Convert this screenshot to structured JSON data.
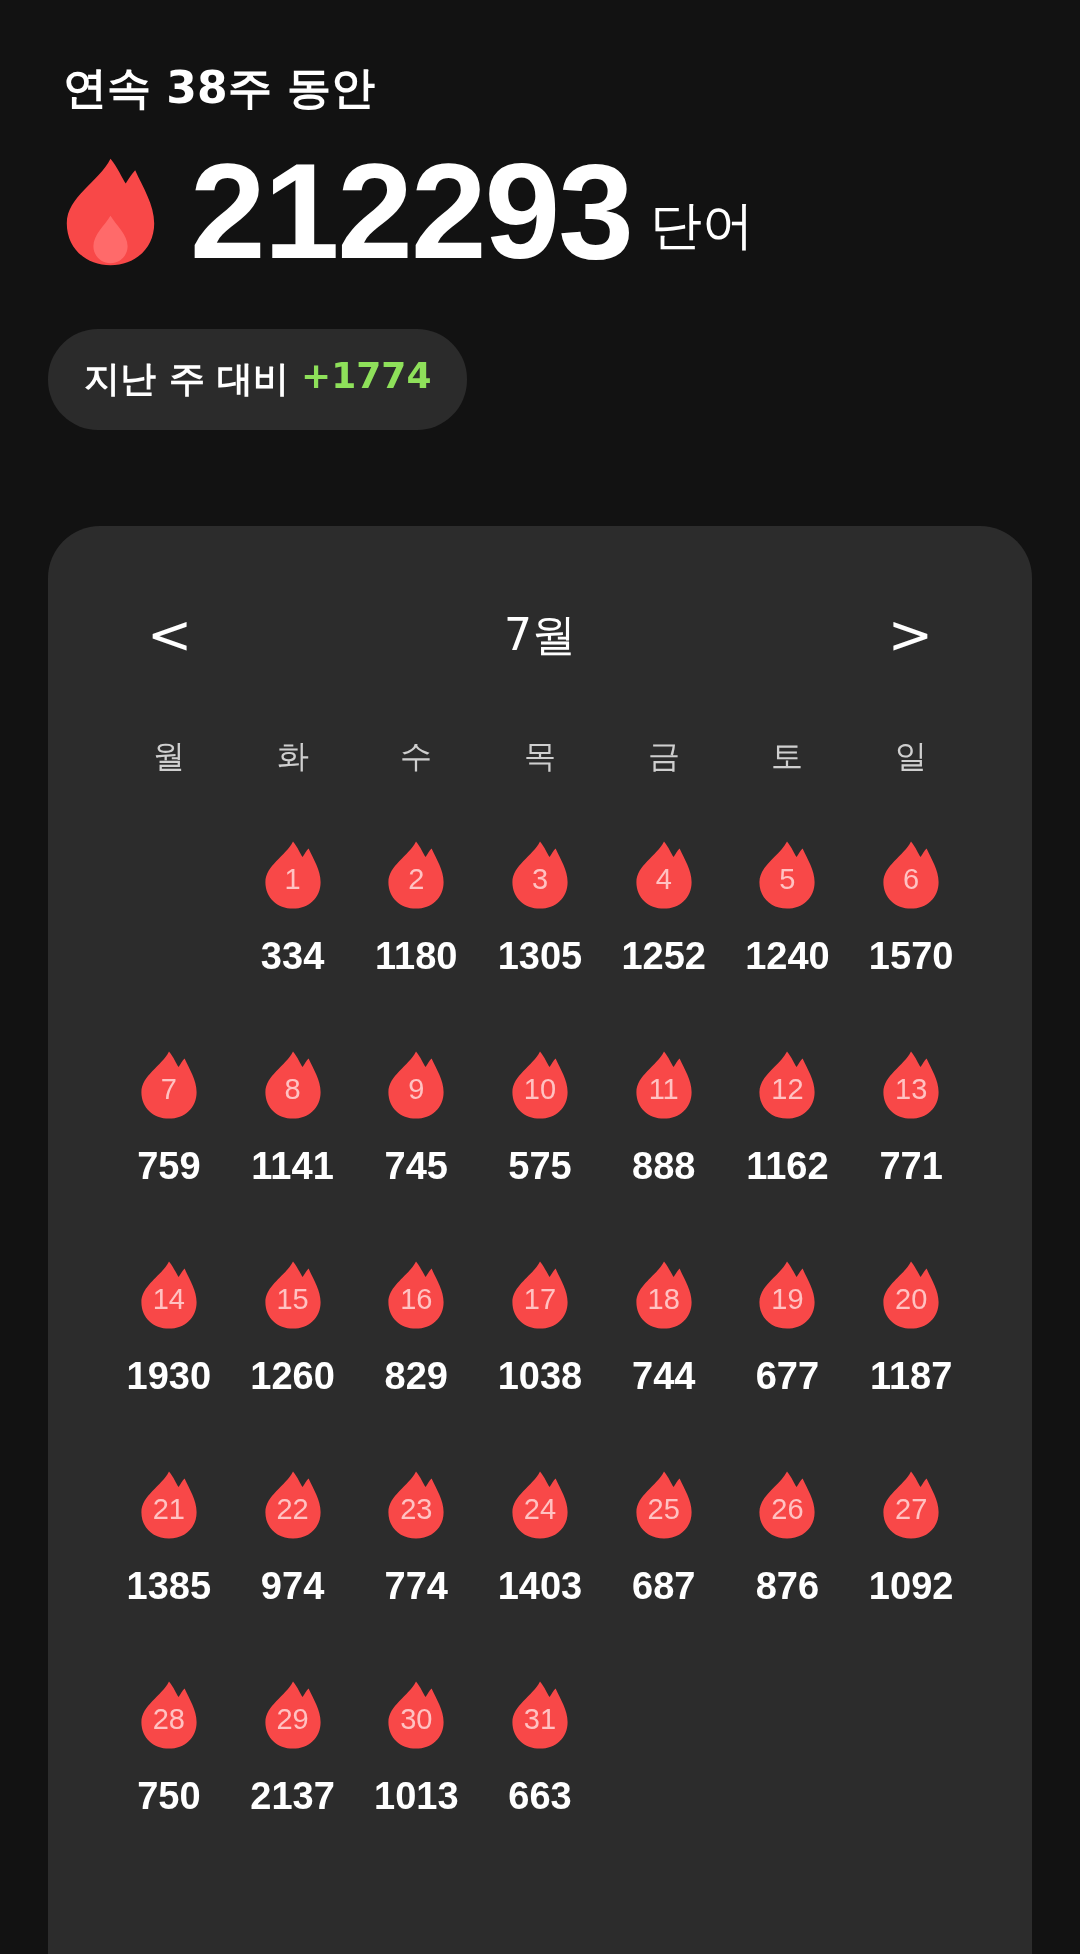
{
  "streak_title": "연속 38주 동안",
  "total": {
    "value": "212293",
    "unit": "단어"
  },
  "comparison": {
    "label": "지난 주 대비",
    "delta": "+1774"
  },
  "calendar": {
    "prev": "<",
    "month": "7월",
    "next": ">",
    "weekdays": [
      "월",
      "화",
      "수",
      "목",
      "금",
      "토",
      "일"
    ],
    "weeks": [
      [
        {
          "kind": "empty"
        },
        {
          "kind": "day",
          "day": "1",
          "words": "334"
        },
        {
          "kind": "day",
          "day": "2",
          "words": "1180"
        },
        {
          "kind": "day",
          "day": "3",
          "words": "1305"
        },
        {
          "kind": "day",
          "day": "4",
          "words": "1252"
        },
        {
          "kind": "day",
          "day": "5",
          "words": "1240"
        },
        {
          "kind": "day",
          "day": "6",
          "words": "1570"
        }
      ],
      [
        {
          "kind": "day",
          "day": "7",
          "words": "759"
        },
        {
          "kind": "day",
          "day": "8",
          "words": "1141"
        },
        {
          "kind": "day",
          "day": "9",
          "words": "745"
        },
        {
          "kind": "day",
          "day": "10",
          "words": "575"
        },
        {
          "kind": "day",
          "day": "11",
          "words": "888"
        },
        {
          "kind": "day",
          "day": "12",
          "words": "1162"
        },
        {
          "kind": "day",
          "day": "13",
          "words": "771"
        }
      ],
      [
        {
          "kind": "day",
          "day": "14",
          "words": "1930"
        },
        {
          "kind": "day",
          "day": "15",
          "words": "1260"
        },
        {
          "kind": "day",
          "day": "16",
          "words": "829"
        },
        {
          "kind": "day",
          "day": "17",
          "words": "1038"
        },
        {
          "kind": "day",
          "day": "18",
          "words": "744"
        },
        {
          "kind": "day",
          "day": "19",
          "words": "677"
        },
        {
          "kind": "day",
          "day": "20",
          "words": "1187"
        }
      ],
      [
        {
          "kind": "day",
          "day": "21",
          "words": "1385"
        },
        {
          "kind": "day",
          "day": "22",
          "words": "974"
        },
        {
          "kind": "day",
          "day": "23",
          "words": "774"
        },
        {
          "kind": "day",
          "day": "24",
          "words": "1403"
        },
        {
          "kind": "day",
          "day": "25",
          "words": "687"
        },
        {
          "kind": "day",
          "day": "26",
          "words": "876"
        },
        {
          "kind": "day",
          "day": "27",
          "words": "1092"
        }
      ],
      [
        {
          "kind": "day",
          "day": "28",
          "words": "750"
        },
        {
          "kind": "day",
          "day": "29",
          "words": "2137"
        },
        {
          "kind": "day",
          "day": "30",
          "words": "1013"
        },
        {
          "kind": "day",
          "day": "31",
          "words": "663"
        }
      ]
    ]
  }
}
